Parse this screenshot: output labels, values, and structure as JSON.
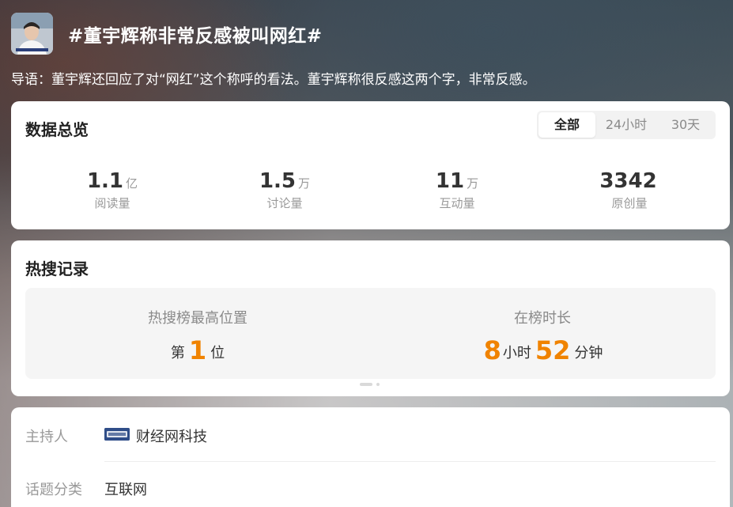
{
  "topic": {
    "title": "#董宇辉称非常反感被叫网红#",
    "lead": "导语：董宇辉还回应了对“网红”这个称呼的看法。董宇辉称很反感这两个字，非常反感。"
  },
  "overview": {
    "title": "数据总览",
    "tabs": [
      {
        "label": "全部",
        "active": true
      },
      {
        "label": "24小时",
        "active": false
      },
      {
        "label": "30天",
        "active": false
      }
    ],
    "stats": [
      {
        "value": "1.1",
        "unit": "亿",
        "label": "阅读量"
      },
      {
        "value": "1.5",
        "unit": "万",
        "label": "讨论量"
      },
      {
        "value": "11",
        "unit": "万",
        "label": "互动量"
      },
      {
        "value": "3342",
        "unit": "",
        "label": "原创量"
      }
    ]
  },
  "hot_search": {
    "title": "热搜记录",
    "highest": {
      "label": "热搜榜最高位置",
      "prefix": "第",
      "value": "1",
      "suffix": "位"
    },
    "duration": {
      "label": "在榜时长",
      "hours": "8",
      "hours_unit": "小时",
      "minutes": "52",
      "minutes_unit": "分钟"
    }
  },
  "info": {
    "host_label": "主持人",
    "host_value": "财经网科技",
    "category_label": "话题分类",
    "category_value": "互联网"
  },
  "colors": {
    "accent": "#f08300",
    "card_bg": "#ffffff",
    "muted_text": "#999999"
  }
}
